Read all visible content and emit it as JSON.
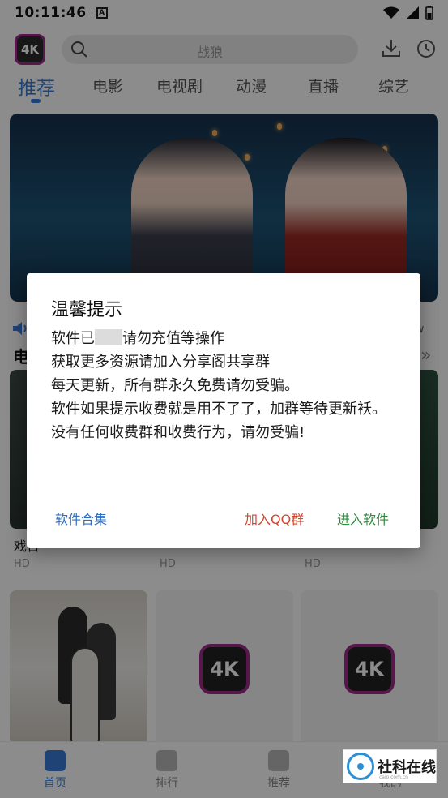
{
  "status_bar": {
    "time": "10:11:46",
    "notification_glyph": "A"
  },
  "header": {
    "logo_text": "4K",
    "search_placeholder": "战狼"
  },
  "tabs": [
    {
      "label": "推荐",
      "active": true
    },
    {
      "label": "电影",
      "active": false
    },
    {
      "label": "电视剧",
      "active": false
    },
    {
      "label": "动漫",
      "active": false
    },
    {
      "label": "直播",
      "active": false
    },
    {
      "label": "综艺",
      "active": false
    }
  ],
  "content": {
    "section_title": "电",
    "partial_text": "w",
    "row1": [
      {
        "title": "戏台",
        "tag": "HD"
      },
      {
        "title": "",
        "tag": "HD"
      },
      {
        "title": "",
        "tag": "HD"
      }
    ],
    "row2_logos": [
      "4K",
      "4K"
    ]
  },
  "dialog": {
    "title": "温馨提示",
    "line1_prefix": "软件已",
    "line1_suffix": "请勿充值等操作",
    "line2": "获取更多资源请加入分享阁共享群",
    "line3": "每天更新，所有群永久免费请勿受骗。",
    "line4": "软件如果提示收费就是用不了了，加群等待更新袄。",
    "line5": "没有任何收费群和收费行为，请勿受骗!",
    "buttons": {
      "collection": "软件合集",
      "join_qq": "加入QQ群",
      "enter": "进入软件"
    }
  },
  "bottom_nav": [
    {
      "label": "首页",
      "active": true
    },
    {
      "label": "排行",
      "active": false
    },
    {
      "label": "推荐",
      "active": false
    },
    {
      "label": "我的",
      "active": false
    }
  ],
  "watermark": {
    "name": "社科在线",
    "sub": "caio.com.cn"
  },
  "colors": {
    "accent": "#3a7bd5",
    "qq_button": "#d2442c",
    "enter_button": "#2e8b3c",
    "collection_button": "#2f6fc2"
  }
}
